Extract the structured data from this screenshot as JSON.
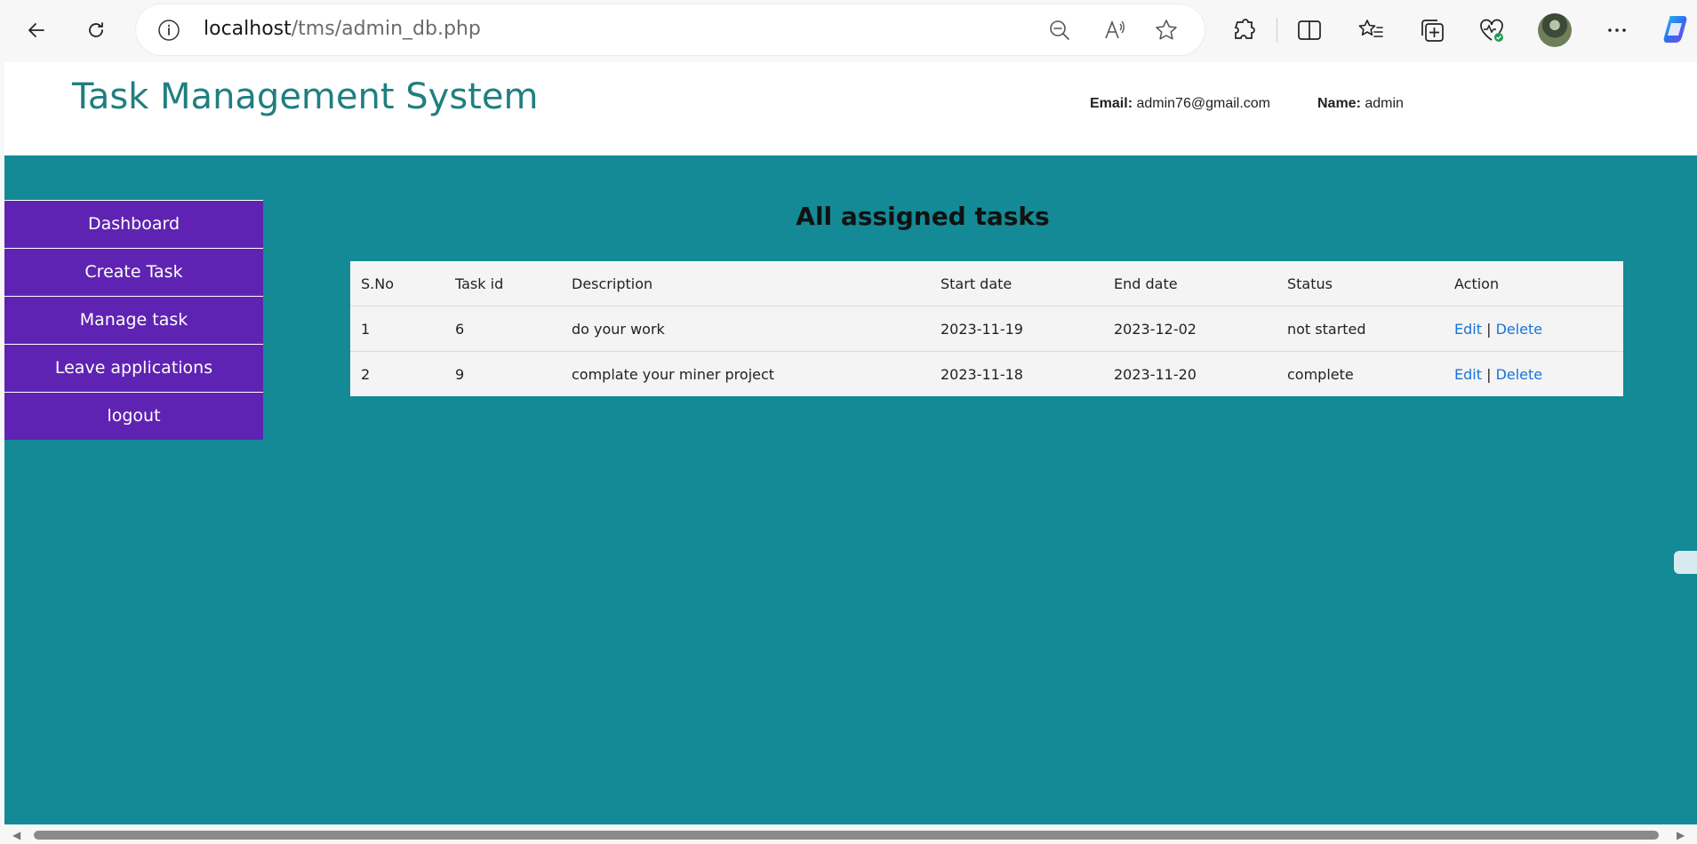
{
  "browser": {
    "url_host": "localhost",
    "url_path": "/tms/admin_db.php",
    "icons": [
      "back-icon",
      "refresh-icon",
      "info-icon",
      "zoom-out-icon",
      "read-aloud-icon",
      "favorite-star-icon",
      "extensions-icon",
      "split-screen-icon",
      "favorites-icon",
      "collections-icon",
      "browser-essentials-icon",
      "profile-avatar",
      "more-icon",
      "copilot-icon"
    ]
  },
  "header": {
    "title": "Task Management System",
    "email_label": "Email:",
    "email_value": "admin76@gmail.com",
    "name_label": "Name:",
    "name_value": "admin"
  },
  "sidebar": {
    "items": [
      {
        "label": "Dashboard"
      },
      {
        "label": "Create Task"
      },
      {
        "label": "Manage task"
      },
      {
        "label": "Leave applications"
      },
      {
        "label": "logout"
      }
    ]
  },
  "main": {
    "heading": "All assigned tasks",
    "columns": [
      "S.No",
      "Task id",
      "Description",
      "Start date",
      "End date",
      "Status",
      "Action"
    ],
    "rows": [
      {
        "sno": "1",
        "task_id": "6",
        "description": "do your work",
        "start": "2023-11-19",
        "end": "2023-12-02",
        "status": "not started",
        "edit": "Edit",
        "sep": "|",
        "delete": "Delete"
      },
      {
        "sno": "2",
        "task_id": "9",
        "description": "complate your miner project",
        "start": "2023-11-18",
        "end": "2023-11-20",
        "status": "complete",
        "edit": "Edit",
        "sep": "|",
        "delete": "Delete"
      }
    ]
  },
  "colors": {
    "brand_title": "#1f7f80",
    "main_bg": "#138a96",
    "sidebar_bg": "#5f23b3",
    "link": "#1a73d9"
  }
}
